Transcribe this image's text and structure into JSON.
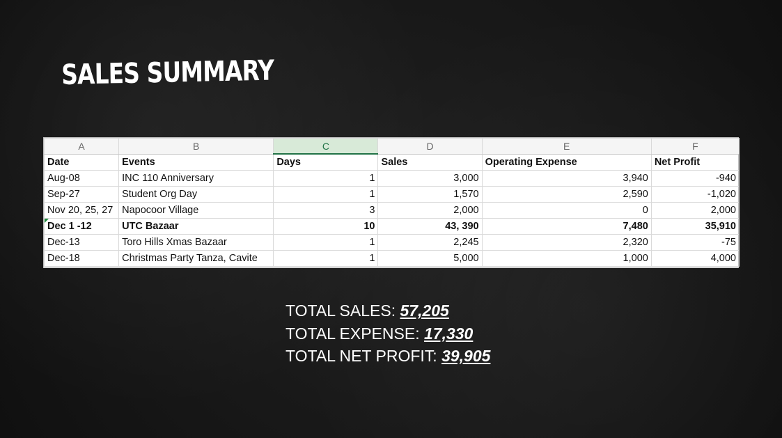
{
  "title": "SALES SUMMARY",
  "spreadsheet": {
    "column_letters": [
      "A",
      "B",
      "C",
      "D",
      "E",
      "F"
    ],
    "selected_column": "C",
    "headers": [
      "Date",
      "Events",
      "Days",
      "Sales",
      "Operating Expense",
      "Net Profit"
    ],
    "rows": [
      [
        "Aug-08",
        "INC 110 Anniversary",
        "1",
        "3,000",
        "3,940",
        "-940"
      ],
      [
        "Sep-27",
        "Student Org Day",
        "1",
        "1,570",
        "2,590",
        "-1,020"
      ],
      [
        "Nov 20, 25, 27",
        "Napocoor Village",
        "3",
        "2,000",
        "0",
        "2,000"
      ],
      [
        "Dec 1 -12",
        "UTC Bazaar",
        "10",
        "43, 390",
        "7,480",
        "35,910"
      ],
      [
        "Dec-13",
        "Toro Hills Xmas Bazaar",
        "1",
        "2,245",
        "2,320",
        "-75"
      ],
      [
        "Dec-18",
        "Christmas Party Tanza, Cavite",
        "1",
        "5,000",
        "1,000",
        "4,000"
      ]
    ],
    "bold_row_index": 3,
    "cell_flag_color": "#1e8a3c"
  },
  "totals": {
    "sales_label": "TOTAL SALES: ",
    "sales_value": "57,205",
    "expense_label": "TOTAL EXPENSE: ",
    "expense_value": "17,330",
    "profit_label": "TOTAL NET PROFIT: ",
    "profit_value": "39,905"
  },
  "colors": {
    "background": "#161616",
    "text": "#ffffff",
    "selected_header": "#217346"
  }
}
